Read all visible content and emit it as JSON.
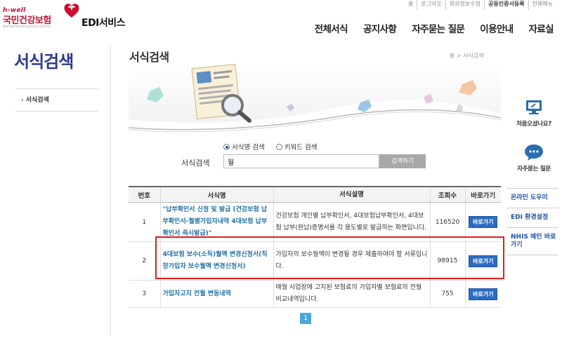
{
  "util_nav": [
    "홈",
    "로그아웃",
    "회원정보수정",
    "공동인증서등록",
    "전체메뉴"
  ],
  "logo": {
    "tagline": "h-well",
    "name": "국민건강보험",
    "sub": "National Health Insurance Service",
    "service": "EDI서비스"
  },
  "gnb": [
    "전체서식",
    "공지사항",
    "자주묻는 질문",
    "이용안내",
    "자료실"
  ],
  "lnb": {
    "title": "서식검색",
    "items": [
      "서식검색"
    ]
  },
  "content": {
    "title": "서식검색",
    "breadcrumb": "홈 > 서식검색"
  },
  "search": {
    "radio_options": [
      "서식명 검색",
      "키워드 검색"
    ],
    "selected_radio": "서식명 검색",
    "label": "서식검색",
    "value": "월",
    "button": "검색하기"
  },
  "table": {
    "headers": [
      "번호",
      "서식명",
      "서식설명",
      "조회수",
      "바로가기"
    ],
    "rows": [
      {
        "no": "1",
        "name": "\"납부확인서 신청 및 발급 (건강보험 납부확인서-월별가입자내역 4대보험 납부확인서 즉시발급)\"",
        "desc": "건강보험 개인별 납부확인서, 4대보험납부확인서, 4대보험 납부(완납)증명서를 각 용도별로 발급하는 화면입니다.",
        "count": "116520",
        "go": "바로가기"
      },
      {
        "no": "2",
        "name": "4대보험 보수(소득)월액 변경신청서(직장가입자 보수월액 변경신청서)",
        "desc": "가입자의 보수월액이 변경될 경우 제출하여야 할 서류입니다.",
        "count": "98915",
        "go": "바로가기"
      },
      {
        "no": "3",
        "name": "가입자고지 전월 변동내역",
        "desc": "매월 사업장에 고지된 보험료의 가입자별 보험료의 전월 비교내역입니다.",
        "count": "755",
        "go": "바로가기"
      }
    ]
  },
  "pagination": {
    "current": "1"
  },
  "quick_menu": [
    "처음오셨나요?",
    "자주묻는 질문"
  ],
  "side_links": [
    "온라인 도우미",
    "EDI 환경설정",
    "NHIS 메인 바로가기"
  ],
  "colors": {
    "brand_red": "#c8102e",
    "title_blue": "#2b3a8f",
    "link_blue": "#1f6fa8",
    "button_blue": "#2b6cc4",
    "highlight_red": "#e31b1b"
  }
}
